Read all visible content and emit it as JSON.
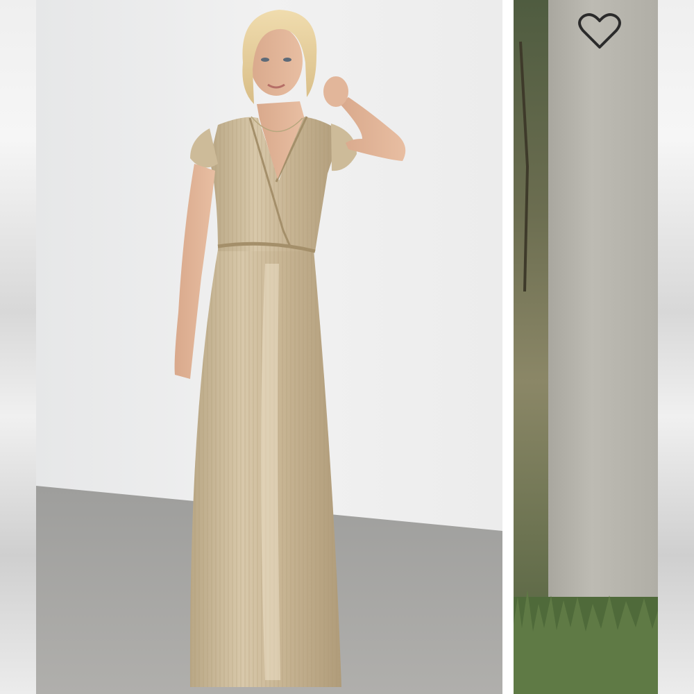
{
  "gallery": {
    "main_image": {
      "subject": "model-in-gold-pleated-maxi-dress"
    },
    "secondary_image": {
      "subject": "dress-detail-outdoor"
    }
  },
  "favorite_button": {
    "icon": "heart-outline-icon",
    "color": "#2b2b2b",
    "state": "not-favorited"
  },
  "colors": {
    "wall": "#ececec",
    "floor": "#a7a7a5",
    "dress": "#c9b797",
    "foliage": "#5c6b47",
    "panel": "#b8b6ae"
  }
}
